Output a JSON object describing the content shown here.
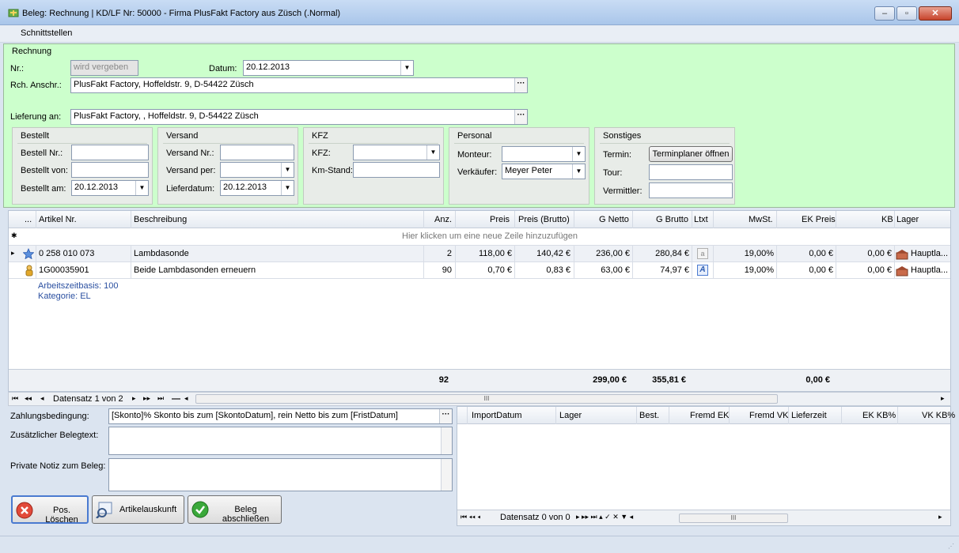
{
  "window": {
    "title": "Beleg: Rechnung | KD/LF Nr: 50000 - Firma PlusFakt Factory  aus Züsch (.Normal)",
    "minimize": "‒",
    "maximize": "▫",
    "close": "✕"
  },
  "menu": {
    "schnittstellen": "Schnittstellen"
  },
  "form": {
    "legend": "Rechnung",
    "nr_label": "Nr.:",
    "nr_value": "wird vergeben",
    "datum_label": "Datum:",
    "datum_value": "20.12.2013",
    "rch_label": "Rch. Anschr.:",
    "rch_value": "PlusFakt Factory,  Hoffeldstr. 9,  D-54422 Züsch",
    "lief_label": "Lieferung an:",
    "lief_value": "PlusFakt Factory, ,  Hoffeldstr. 9,  D-54422 Züsch",
    "ellipsis": "···"
  },
  "bestellt": {
    "title": "Bestellt",
    "nr_label": "Bestell Nr.:",
    "von_label": "Bestellt von:",
    "am_label": "Bestellt am:",
    "am_value": "20.12.2013"
  },
  "versand": {
    "title": "Versand",
    "nr_label": "Versand Nr.:",
    "per_label": "Versand per:",
    "datum_label": "Lieferdatum:",
    "datum_value": "20.12.2013"
  },
  "kfz": {
    "title": "KFZ",
    "kfz_label": "KFZ:",
    "km_label": "Km-Stand:"
  },
  "personal": {
    "title": "Personal",
    "monteur_label": "Monteur:",
    "verk_label": "Verkäufer:",
    "verk_value": "Meyer Peter"
  },
  "sonstiges": {
    "title": "Sonstiges",
    "termin_label": "Termin:",
    "termin_button": "Terminplaner öffnen",
    "tour_label": "Tour:",
    "vermittler_label": "Vermittler:"
  },
  "grid": {
    "headers": {
      "dots": "...",
      "artnr": "Artikel Nr.",
      "beschr": "Beschreibung",
      "anz": "Anz.",
      "preis": "Preis",
      "preis_brutto": "Preis (Brutto)",
      "gnetto": "G Netto",
      "gbrutto": "G Brutto",
      "ltxt": "Ltxt",
      "mwst": "MwSt.",
      "ekpreis": "EK Preis",
      "kb": "KB",
      "lager": "Lager"
    },
    "new_row_marker": "✱",
    "new_row_hint": "Hier klicken um eine neue Zeile hinzuzufügen",
    "rows": [
      {
        "indicator": "▸",
        "artnr": "0 258 010 073",
        "beschr": "Lambdasonde",
        "anz": "2",
        "preis": "118,00 €",
        "preis_brutto": "140,42 €",
        "gnetto": "236,00 €",
        "gbrutto": "280,84 €",
        "ltxt": "a",
        "mwst": "19,00%",
        "ekpreis": "0,00 €",
        "kb": "0,00 €",
        "lager": "Hauptla..."
      },
      {
        "indicator": "",
        "artnr": "1G00035901",
        "beschr": "Beide Lambdasonden erneuern",
        "anz": "90",
        "preis": "0,70 €",
        "preis_brutto": "0,83 €",
        "gnetto": "63,00 €",
        "gbrutto": "74,97 €",
        "ltxt": "A",
        "mwst": "19,00%",
        "ekpreis": "0,00 €",
        "kb": "0,00 €",
        "lager": "Hauptla...",
        "detail1": "Arbeitszeitbasis: 100",
        "detail2": "Kategorie: EL"
      }
    ],
    "footer": {
      "anz": "92",
      "gnetto": "299,00 €",
      "gbrutto": "355,81 €",
      "ekpreis": "0,00 €"
    }
  },
  "nav": {
    "first": "⏮",
    "prev_page": "◂◂",
    "prev": "◂",
    "text": "Datensatz 1 von 2",
    "next": "▸",
    "next_page": "▸▸",
    "last": "⏭",
    "delete": "—",
    "scroll_left": "◂",
    "scroll_thumb": "III",
    "scroll_right": "▸"
  },
  "bottom": {
    "zahlung_label": "Zahlungsbedingung:",
    "zahlung_value": "[Skonto]% Skonto bis zum [SkontoDatum], rein Netto bis zum  [FristDatum]",
    "zus_label": "Zusätzlicher Belegtext:",
    "notiz_label": "Private Notiz zum Beleg:",
    "pos_loeschen": "Pos. Löschen",
    "artikelauskunft": "Artikelauskunft",
    "beleg_abschliessen": "Beleg abschließen"
  },
  "right_grid": {
    "headers": {
      "importdatum": "ImportDatum",
      "lager": "Lager",
      "best": "Best.",
      "fremdek": "Fremd EK",
      "fremdvk": "Fremd VK",
      "lieferzeit": "Lieferzeit",
      "ekkb": "EK KB%",
      "vkkb": "VK KB%"
    },
    "nav_text": "Datensatz 0 von 0",
    "nav_icons": "⏮  ◂◂  ◂",
    "nav_icons2": "▸  ▸▸  ⏭  ▴  ✓  ✕  ▼  ◂"
  },
  "colors": {
    "form_bg": "#ccffcc",
    "window_bg": "#dbe4f0",
    "link_blue": "#2a4fa0"
  }
}
